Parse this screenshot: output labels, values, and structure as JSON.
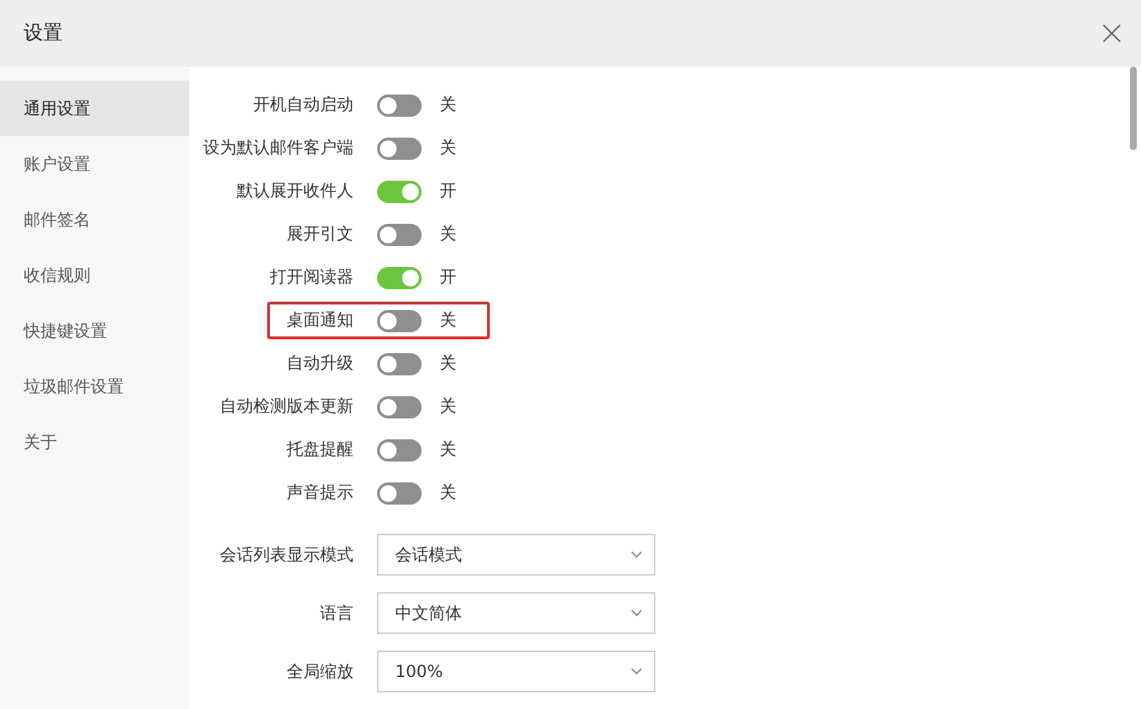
{
  "window": {
    "title": "设置"
  },
  "sidebar": {
    "items": [
      {
        "label": "通用设置",
        "selected": true
      },
      {
        "label": "账户设置",
        "selected": false
      },
      {
        "label": "邮件签名",
        "selected": false
      },
      {
        "label": "收信规则",
        "selected": false
      },
      {
        "label": "快捷键设置",
        "selected": false
      },
      {
        "label": "垃圾邮件设置",
        "selected": false
      },
      {
        "label": "关于",
        "selected": false
      }
    ]
  },
  "settings": [
    {
      "kind": "toggle",
      "label": "开机自动启动",
      "on": false,
      "state_text": "关",
      "highlighted": false
    },
    {
      "kind": "toggle",
      "label": "设为默认邮件客户端",
      "on": false,
      "state_text": "关",
      "highlighted": false
    },
    {
      "kind": "toggle",
      "label": "默认展开收件人",
      "on": true,
      "state_text": "开",
      "highlighted": false
    },
    {
      "kind": "toggle",
      "label": "展开引文",
      "on": false,
      "state_text": "关",
      "highlighted": false
    },
    {
      "kind": "toggle",
      "label": "打开阅读器",
      "on": true,
      "state_text": "开",
      "highlighted": false
    },
    {
      "kind": "toggle",
      "label": "桌面通知",
      "on": false,
      "state_text": "关",
      "highlighted": true
    },
    {
      "kind": "toggle",
      "label": "自动升级",
      "on": false,
      "state_text": "关",
      "highlighted": false
    },
    {
      "kind": "toggle",
      "label": "自动检测版本更新",
      "on": false,
      "state_text": "关",
      "highlighted": false
    },
    {
      "kind": "toggle",
      "label": "托盘提醒",
      "on": false,
      "state_text": "关",
      "highlighted": false
    },
    {
      "kind": "toggle",
      "label": "声音提示",
      "on": false,
      "state_text": "关",
      "highlighted": false
    },
    {
      "kind": "select",
      "label": "会话列表显示模式",
      "value": "会话模式",
      "highlighted": false
    },
    {
      "kind": "select",
      "label": "语言",
      "value": "中文简体",
      "highlighted": false
    },
    {
      "kind": "select",
      "label": "全局缩放",
      "value": "100%",
      "highlighted": false
    }
  ]
}
